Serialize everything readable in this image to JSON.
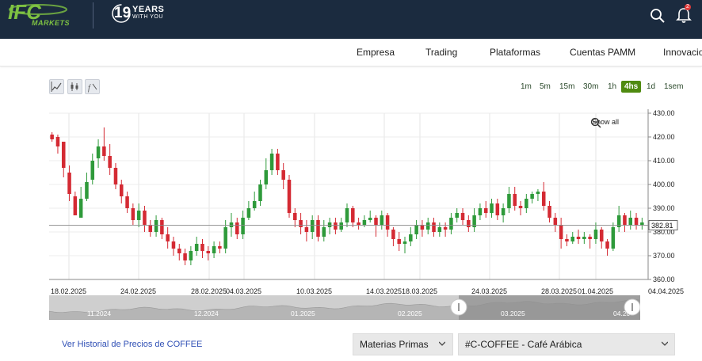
{
  "header": {
    "logo_text": "IFC",
    "logo_sub": "MARKETS",
    "years_number": "19",
    "years_line1": "YEARS",
    "years_line2": "WITH YOU",
    "notification_count": "2"
  },
  "nav": {
    "items": [
      "Empresa",
      "Trading",
      "Plataformas",
      "Cuentas PAMM",
      "Innovacion"
    ]
  },
  "toolbar": {
    "timeframes": [
      "1m",
      "5m",
      "15m",
      "30m",
      "1h",
      "4hs",
      "1d",
      "1sem"
    ],
    "active_timeframe": "4hs",
    "show_all_label": "Show all"
  },
  "chart_data": {
    "type": "candlestick",
    "ylim": [
      360,
      430
    ],
    "y_ticks": [
      "430.00",
      "420.00",
      "410.00",
      "400.00",
      "390.00",
      "380.00",
      "370.00",
      "360.00"
    ],
    "x_tick_labels": [
      "18.02.2025",
      "24.02.2025",
      "28.02.2025",
      "04.03.2025",
      "10.03.2025",
      "14.03.2025",
      "18.03.2025",
      "24.03.2025",
      "28.03.2025",
      "01.04.2025",
      "04.04.2025"
    ],
    "current_price": "382.81",
    "colors": {
      "up": "#2e9a3a",
      "down": "#d42a33"
    },
    "candles": [
      [
        421,
        419,
        422,
        418
      ],
      [
        420,
        416,
        421,
        413
      ],
      [
        418,
        407,
        418,
        403
      ],
      [
        405,
        396,
        408,
        393
      ],
      [
        395,
        387,
        397,
        390
      ],
      [
        386,
        394,
        399,
        388
      ],
      [
        394,
        401,
        405,
        393
      ],
      [
        402,
        410,
        413,
        400
      ],
      [
        411,
        416,
        419,
        407
      ],
      [
        416,
        412,
        424,
        410
      ],
      [
        412,
        407,
        417,
        404
      ],
      [
        407,
        400,
        409,
        398
      ],
      [
        400,
        395,
        402,
        392
      ],
      [
        395,
        390,
        397,
        388
      ],
      [
        390,
        385,
        392,
        383
      ],
      [
        385,
        389,
        392,
        382
      ],
      [
        389,
        383,
        391,
        380
      ],
      [
        383,
        380,
        385,
        378
      ],
      [
        380,
        385,
        387,
        378
      ],
      [
        385,
        379,
        386,
        377
      ],
      [
        379,
        376,
        382,
        373
      ],
      [
        376,
        373,
        378,
        370
      ],
      [
        373,
        371,
        375,
        368
      ],
      [
        371,
        368,
        373,
        366
      ],
      [
        368,
        372,
        374,
        366
      ],
      [
        372,
        375,
        378,
        370
      ],
      [
        375,
        372,
        377,
        369
      ],
      [
        372,
        371,
        374,
        368
      ],
      [
        371,
        374,
        376,
        369
      ],
      [
        374,
        373,
        376,
        371
      ],
      [
        373,
        382,
        385,
        371
      ],
      [
        382,
        384,
        388,
        378
      ],
      [
        384,
        379,
        386,
        377
      ],
      [
        379,
        386,
        389,
        377
      ],
      [
        386,
        390,
        393,
        385
      ],
      [
        390,
        393,
        397,
        389
      ],
      [
        393,
        400,
        402,
        391
      ],
      [
        400,
        406,
        411,
        398
      ],
      [
        406,
        413,
        415,
        404
      ],
      [
        413,
        406,
        415,
        404
      ],
      [
        406,
        402,
        409,
        398
      ],
      [
        402,
        388,
        404,
        386
      ],
      [
        388,
        385,
        390,
        382
      ],
      [
        385,
        382,
        388,
        379
      ],
      [
        382,
        380,
        385,
        376
      ],
      [
        380,
        385,
        387,
        377
      ],
      [
        385,
        378,
        387,
        376
      ],
      [
        378,
        382,
        385,
        376
      ],
      [
        382,
        384,
        386,
        379
      ],
      [
        384,
        381,
        386,
        379
      ],
      [
        381,
        384,
        386,
        380
      ],
      [
        384,
        390,
        392,
        382
      ],
      [
        390,
        384,
        391,
        382
      ],
      [
        384,
        383,
        386,
        381
      ],
      [
        383,
        385,
        387,
        382
      ],
      [
        385,
        386,
        389,
        384
      ],
      [
        386,
        383,
        387,
        378
      ],
      [
        383,
        387,
        389,
        381
      ],
      [
        387,
        381,
        388,
        378
      ],
      [
        381,
        377,
        382,
        374
      ],
      [
        377,
        375,
        380,
        372
      ],
      [
        375,
        376,
        378,
        371
      ],
      [
        376,
        379,
        382,
        374
      ],
      [
        379,
        383,
        385,
        377
      ],
      [
        383,
        381,
        385,
        378
      ],
      [
        381,
        384,
        386,
        379
      ],
      [
        384,
        380,
        386,
        378
      ],
      [
        380,
        382,
        384,
        378
      ],
      [
        382,
        381,
        384,
        378
      ],
      [
        381,
        386,
        388,
        379
      ],
      [
        386,
        388,
        390,
        384
      ],
      [
        388,
        385,
        390,
        383
      ],
      [
        385,
        382,
        387,
        380
      ],
      [
        382,
        387,
        390,
        380
      ],
      [
        387,
        390,
        392,
        385
      ],
      [
        390,
        388,
        393,
        386
      ],
      [
        388,
        392,
        394,
        386
      ],
      [
        392,
        387,
        394,
        385
      ],
      [
        387,
        390,
        392,
        384
      ],
      [
        390,
        396,
        399,
        388
      ],
      [
        396,
        391,
        399,
        389
      ],
      [
        391,
        390,
        393,
        387
      ],
      [
        390,
        394,
        396,
        388
      ],
      [
        394,
        396,
        397,
        392
      ],
      [
        396,
        397,
        398,
        393
      ],
      [
        397,
        391,
        401,
        389
      ],
      [
        391,
        386,
        393,
        384
      ],
      [
        386,
        383,
        388,
        380
      ],
      [
        383,
        377,
        386,
        373
      ],
      [
        377,
        376,
        379,
        374
      ],
      [
        376,
        378,
        380,
        375
      ],
      [
        378,
        377,
        381,
        375
      ],
      [
        377,
        378,
        380,
        375
      ],
      [
        378,
        377,
        379,
        373
      ],
      [
        377,
        381,
        384,
        375
      ],
      [
        381,
        376,
        382,
        373
      ],
      [
        376,
        373,
        377,
        370
      ],
      [
        373,
        382,
        384,
        372
      ],
      [
        382,
        387,
        391,
        380
      ],
      [
        387,
        383,
        388,
        380
      ],
      [
        383,
        386,
        389,
        381
      ],
      [
        386,
        383,
        388,
        381
      ],
      [
        383,
        384,
        386,
        381
      ]
    ],
    "navigator_labels": [
      "11.2024",
      "12.2024",
      "01.2025",
      "02.2025",
      "03.2025",
      "04.20"
    ]
  },
  "footer": {
    "history_link": "Ver Historial de Precios de COFFEE",
    "category_select": "Materias Primas",
    "instrument_select": "#C-COFFEE - Café Arábica"
  }
}
